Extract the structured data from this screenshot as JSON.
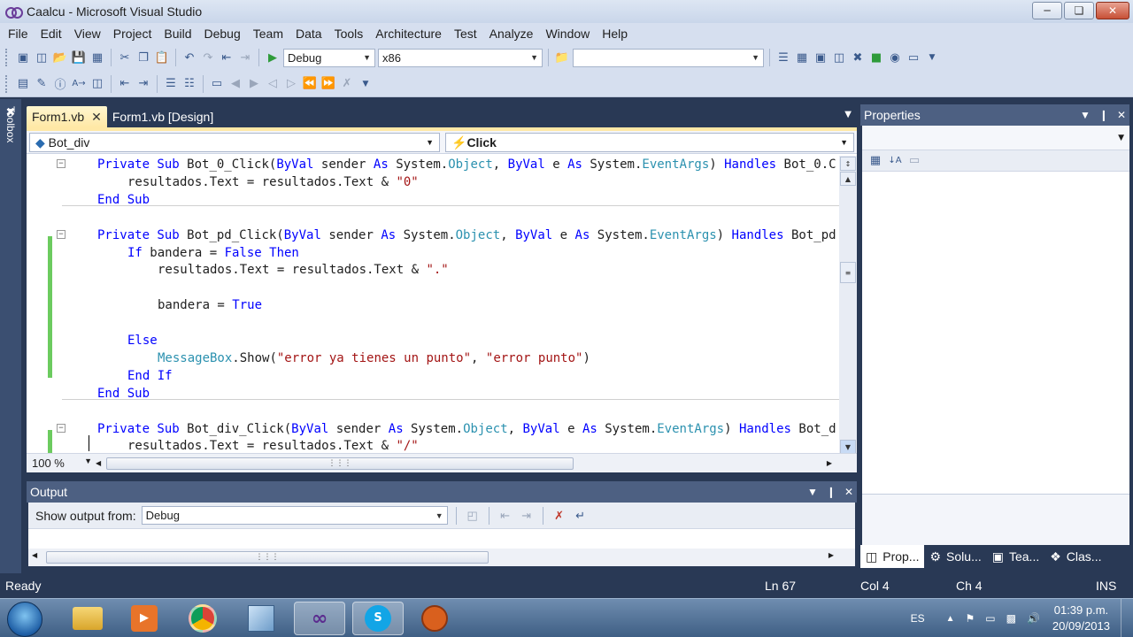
{
  "window": {
    "title": "Caalcu - Microsoft Visual Studio"
  },
  "menu": [
    "File",
    "Edit",
    "View",
    "Project",
    "Build",
    "Debug",
    "Team",
    "Data",
    "Tools",
    "Architecture",
    "Test",
    "Analyze",
    "Window",
    "Help"
  ],
  "toolbar": {
    "config": "Debug",
    "platform": "x86",
    "find_value": ""
  },
  "toolbox_label": "Toolbox",
  "tabs": [
    {
      "label": "Form1.vb",
      "active": true
    },
    {
      "label": "Form1.vb [Design]",
      "active": false
    }
  ],
  "editor": {
    "class_combo": "Bot_div",
    "method_combo": "Click",
    "zoom": "100 %",
    "lines": [
      {
        "row": 0,
        "indent": 0,
        "fold": true,
        "parts": [
          [
            "kw",
            "Private Sub "
          ],
          [
            "",
            "Bot_0_Click("
          ],
          [
            "kw",
            "ByVal"
          ],
          [
            "",
            " sender "
          ],
          [
            "kw",
            "As"
          ],
          [
            "",
            " System."
          ],
          [
            "ty",
            "Object"
          ],
          [
            "",
            ", "
          ],
          [
            "kw",
            "ByVal"
          ],
          [
            "",
            " e "
          ],
          [
            "kw",
            "As"
          ],
          [
            "",
            " System."
          ],
          [
            "ty",
            "EventArgs"
          ],
          [
            "",
            ") "
          ],
          [
            "kw",
            "Handles"
          ],
          [
            "",
            " Bot_0.C"
          ]
        ]
      },
      {
        "row": 1,
        "indent": 1,
        "parts": [
          [
            "",
            "resultados.Text = resultados.Text & "
          ],
          [
            "st",
            "\"0\""
          ]
        ]
      },
      {
        "row": 2,
        "indent": 0,
        "parts": [
          [
            "kw",
            "End Sub"
          ]
        ]
      },
      {
        "row": 4,
        "indent": 0,
        "fold": true,
        "parts": [
          [
            "kw",
            "Private Sub "
          ],
          [
            "",
            "Bot_pd_Click("
          ],
          [
            "kw",
            "ByVal"
          ],
          [
            "",
            " sender "
          ],
          [
            "kw",
            "As"
          ],
          [
            "",
            " System."
          ],
          [
            "ty",
            "Object"
          ],
          [
            "",
            ", "
          ],
          [
            "kw",
            "ByVal"
          ],
          [
            "",
            " e "
          ],
          [
            "kw",
            "As"
          ],
          [
            "",
            " System."
          ],
          [
            "ty",
            "EventArgs"
          ],
          [
            "",
            ") "
          ],
          [
            "kw",
            "Handles"
          ],
          [
            "",
            " Bot_pd"
          ]
        ]
      },
      {
        "row": 5,
        "indent": 1,
        "parts": [
          [
            "kw",
            "If"
          ],
          [
            "",
            " bandera = "
          ],
          [
            "kw",
            "False Then"
          ]
        ]
      },
      {
        "row": 6,
        "indent": 2,
        "parts": [
          [
            "",
            "resultados.Text = resultados.Text & "
          ],
          [
            "st",
            "\".\""
          ]
        ]
      },
      {
        "row": 8,
        "indent": 2,
        "parts": [
          [
            "",
            "bandera = "
          ],
          [
            "kw",
            "True"
          ]
        ]
      },
      {
        "row": 10,
        "indent": 1,
        "parts": [
          [
            "kw",
            "Else"
          ]
        ]
      },
      {
        "row": 11,
        "indent": 2,
        "parts": [
          [
            "ty",
            "MessageBox"
          ],
          [
            "",
            ".Show("
          ],
          [
            "st",
            "\"error ya tienes un punto\""
          ],
          [
            "",
            ", "
          ],
          [
            "st",
            "\"error punto\""
          ],
          [
            "",
            ")"
          ]
        ]
      },
      {
        "row": 12,
        "indent": 1,
        "parts": [
          [
            "kw",
            "End If"
          ]
        ]
      },
      {
        "row": 13,
        "indent": 0,
        "parts": [
          [
            "kw",
            "End Sub"
          ]
        ]
      },
      {
        "row": 15,
        "indent": 0,
        "fold": true,
        "parts": [
          [
            "kw",
            "Private Sub "
          ],
          [
            "",
            "Bot_div_Click("
          ],
          [
            "kw",
            "ByVal"
          ],
          [
            "",
            " sender "
          ],
          [
            "kw",
            "As"
          ],
          [
            "",
            " System."
          ],
          [
            "ty",
            "Object"
          ],
          [
            "",
            ", "
          ],
          [
            "kw",
            "ByVal"
          ],
          [
            "",
            " e "
          ],
          [
            "kw",
            "As"
          ],
          [
            "",
            " System."
          ],
          [
            "ty",
            "EventArgs"
          ],
          [
            "",
            ") "
          ],
          [
            "kw",
            "Handles"
          ],
          [
            "",
            " Bot_d"
          ]
        ]
      },
      {
        "row": 16,
        "indent": 1,
        "parts": [
          [
            "",
            "resultados.Text = resultados.Text & "
          ],
          [
            "st",
            "\"/\""
          ]
        ]
      }
    ]
  },
  "properties": {
    "title": "Properties",
    "tabs": [
      "Prop...",
      "Solu...",
      "Tea...",
      "Clas..."
    ]
  },
  "output": {
    "title": "Output",
    "show_from_label": "Show output from:",
    "show_from_value": "Debug"
  },
  "status": {
    "ready": "Ready",
    "ln": "Ln 67",
    "col": "Col 4",
    "ch": "Ch 4",
    "mode": "INS"
  },
  "taskbar": {
    "lang": "ES",
    "time": "01:39 p.m.",
    "date": "20/09/2013"
  },
  "colors": {
    "keyword": "#0000ff",
    "type": "#2b91af",
    "string": "#a31515",
    "chrome": "#293955",
    "tab_active": "#ffe8a6"
  }
}
